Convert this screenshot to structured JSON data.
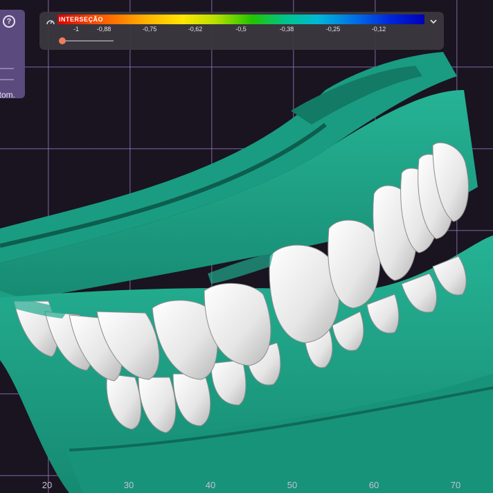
{
  "left_panel": {
    "help_icon": "question-circle-icon",
    "auto_label": "utom."
  },
  "toolbar": {
    "gauge_icon": "gauge-icon",
    "scale_title": "INTERSEÇÃO",
    "scale_ticks": [
      "-1",
      "-0,88",
      "-0,75",
      "-0,62",
      "-0,5",
      "-0,38",
      "-0,25",
      "-0,12"
    ],
    "slider_value": 0,
    "menu_icon": "chevron-down-icon"
  },
  "axis": {
    "x_labels": [
      "20",
      "30",
      "40",
      "50",
      "60",
      "70"
    ]
  },
  "colors": {
    "background": "#19141f",
    "grid": "#9678c8",
    "model_green": "#1fa88d",
    "teeth": "#eceaea",
    "panel_purple": "#5b4a7e",
    "toolbar": "#3a383e",
    "slider_knob": "#f07c5c"
  }
}
